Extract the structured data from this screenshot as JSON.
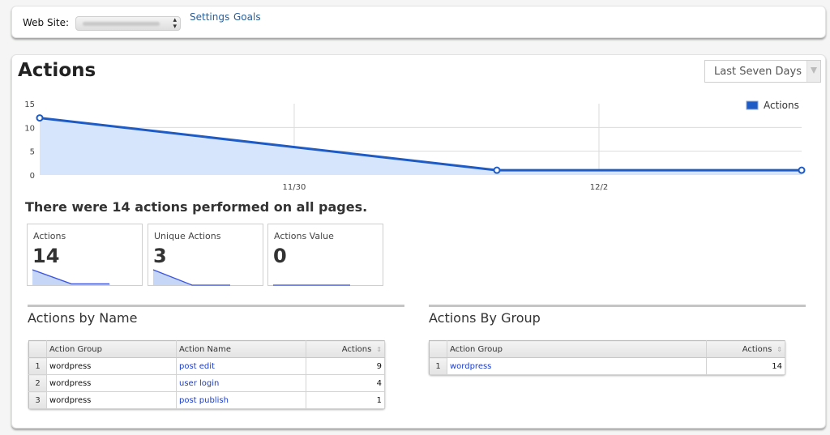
{
  "topbar": {
    "site_label": "Web Site:",
    "site_select_value": "",
    "links": [
      {
        "label": "Settings"
      },
      {
        "label": "Goals"
      }
    ]
  },
  "main": {
    "title": "Actions",
    "range_select": {
      "value": "Last Seven Days"
    },
    "summary": "There were 14 actions performed on all pages.",
    "metrics": [
      {
        "label": "Actions",
        "value": "14",
        "sparkline": [
          12,
          1,
          1
        ]
      },
      {
        "label": "Unique Actions",
        "value": "3",
        "sparkline": [
          3,
          0,
          0
        ]
      },
      {
        "label": "Actions Value",
        "value": "0",
        "sparkline": [
          0,
          0,
          0
        ]
      }
    ],
    "actions_by_name": {
      "title": "Actions by Name",
      "columns": [
        "Action Group",
        "Action Name",
        "Actions"
      ],
      "rows": [
        {
          "index": "1",
          "group": "wordpress",
          "name": "post edit",
          "actions": "9"
        },
        {
          "index": "2",
          "group": "wordpress",
          "name": "user login",
          "actions": "4"
        },
        {
          "index": "3",
          "group": "wordpress",
          "name": "post publish",
          "actions": "1"
        }
      ]
    },
    "actions_by_group": {
      "title": "Actions By Group",
      "columns": [
        "Action Group",
        "Actions"
      ],
      "rows": [
        {
          "index": "1",
          "group": "wordpress",
          "actions": "14"
        }
      ]
    }
  },
  "colors": {
    "series_line": "#1f5bc4",
    "series_fill": "#d6e5fb",
    "link": "#2a5d98",
    "table_link": "#1a3ccc"
  },
  "chart_data": {
    "type": "area",
    "title": "",
    "xlabel": "",
    "ylabel": "",
    "legend": {
      "entries": [
        "Actions"
      ],
      "placement": "top-right"
    },
    "x_ticks": [
      {
        "label": "11/30",
        "day_offset": 1.67
      },
      {
        "label": "12/2",
        "day_offset": 3.67
      }
    ],
    "y_ticks": [
      0,
      5,
      10,
      15
    ],
    "ylim": [
      0,
      15
    ],
    "xlim_days": [
      0,
      5
    ],
    "grid": true,
    "series": [
      {
        "name": "Actions",
        "points": [
          {
            "day_offset": 0,
            "value": 12
          },
          {
            "day_offset": 3,
            "value": 1
          },
          {
            "day_offset": 5,
            "value": 1
          }
        ]
      }
    ]
  }
}
